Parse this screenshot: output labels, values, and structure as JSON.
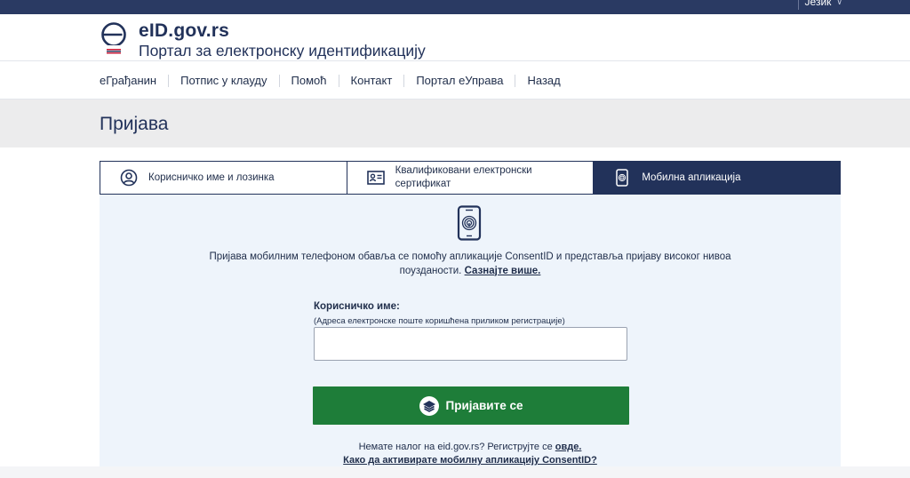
{
  "header": {
    "language_label": "Језик",
    "brand_title": "eID.gov.rs",
    "brand_subtitle": "Портал за електронску идентификацију"
  },
  "nav": {
    "items": [
      "еГрађанин",
      "Потпис у клауду",
      "Помоћ",
      "Контакт",
      "Портал еУправа",
      "Назад"
    ]
  },
  "page": {
    "title": "Пријава"
  },
  "tabs": [
    {
      "label": "Корисничко име и лозинка",
      "icon": "user-circle-icon",
      "active": false
    },
    {
      "label": "Квалификовани електронски сертификат",
      "icon": "id-card-icon",
      "active": false
    },
    {
      "label": "Мобилна апликација",
      "icon": "mobile-fingerprint-icon",
      "active": true
    }
  ],
  "form": {
    "intro_text": "Пријава мобилним телефоном обавља се помоћу апликације ConsentID и представља пријаву високог нивоа поузданости.",
    "intro_link": "Сазнајте више.",
    "username_label": "Корисничко име:",
    "username_hint": "(Адреса електронске поште коришћена приликом регистрације)",
    "username_value": "",
    "login_button": "Пријавите се",
    "register_text": "Немате налог на eid.gov.rs? Региструјте се",
    "register_link": "овде.",
    "howto_link": "Како да активирате мобилну апликацију ConsentID?"
  },
  "colors": {
    "primary": "#22325a",
    "topbar": "#2a3a63",
    "button_green": "#1e7d39",
    "panel_bg": "#eef4fb",
    "title_band": "#ececed"
  }
}
